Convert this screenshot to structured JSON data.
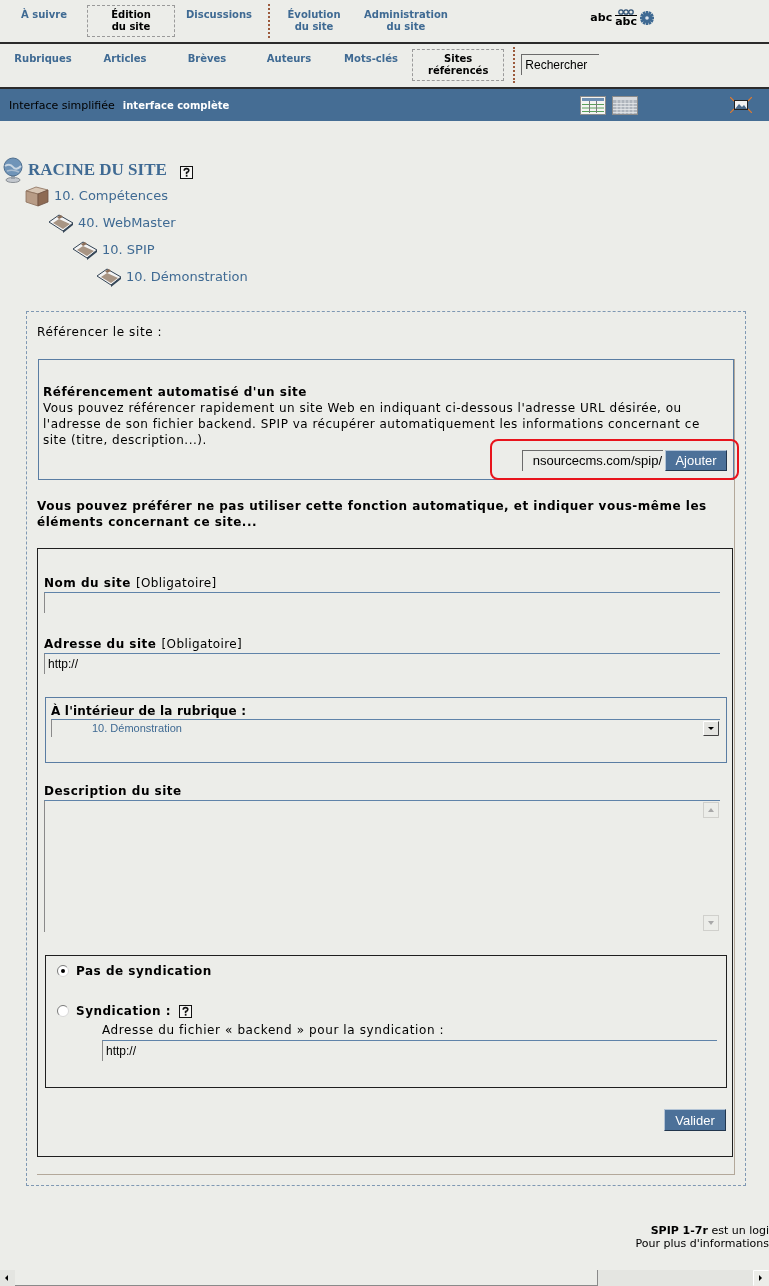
{
  "main_nav": {
    "groups": [
      [
        {
          "label": "À suivre",
          "selected": false
        },
        {
          "label": "Édition du site",
          "selected": true
        },
        {
          "label": "Discussions",
          "selected": false
        }
      ],
      [
        {
          "label": "Évolution du site",
          "selected": false
        },
        {
          "label": "Administration du site",
          "selected": false
        }
      ]
    ],
    "tools": [
      {
        "kind": "text",
        "label": "abc"
      },
      {
        "kind": "stacked",
        "label": "abc"
      },
      {
        "kind": "gear"
      }
    ]
  },
  "sub_nav": {
    "items": [
      {
        "label": "Rubriques",
        "selected": false
      },
      {
        "label": "Articles",
        "selected": false
      },
      {
        "label": "Brèves",
        "selected": false
      },
      {
        "label": "Auteurs",
        "selected": false
      },
      {
        "label": "Mots-clés",
        "selected": false
      },
      {
        "label": "Sites référencés",
        "selected": true
      }
    ],
    "search": {
      "value": "Rechercher"
    }
  },
  "mode_bar": {
    "links": [
      {
        "label": "Interface simplifiée",
        "selected": false
      },
      {
        "label": "interface complète",
        "selected": true
      }
    ]
  },
  "breadcrumb": {
    "title": "RACINE DU SITE",
    "help": true,
    "children": [
      {
        "kind": "sector",
        "label": "10. Compétences",
        "children": [
          {
            "kind": "folder",
            "label": "40. WebMaster",
            "children": [
              {
                "kind": "folder",
                "label": "10. SPIP",
                "children": [
                  {
                    "kind": "folder",
                    "label": "10. Démonstration"
                  }
                ]
              }
            ]
          }
        ]
      }
    ]
  },
  "form": {
    "heading": "Référencer le site :",
    "auto": {
      "title": "Référencement automatisé d'un site",
      "text": "Vous pouvez référencer rapidement un site Web en indiquant ci-dessous l'adresse URL désirée, ou l'adresse de son fichier backend. SPIP va récupérer automatiquement les informations concernant ce site (titre, description...).",
      "url_field": {
        "value": "nsourcecms.com/spip/"
      },
      "button": "Ajouter",
      "highlighted": true
    },
    "manual_intro": "Vous pouvez préférer ne pas utiliser cette fonction automatique, et indiquer vous-même les éléments concernant ce site...",
    "fields": [
      {
        "kind": "text",
        "label": "Nom du site",
        "note": "[Obligatoire]"
      },
      {
        "kind": "text",
        "label": "Adresse du site",
        "note": "[Obligatoire]",
        "value": "http://"
      },
      {
        "kind": "select",
        "label": "À l'intérieur de la rubrique :",
        "value": "10. Démonstration"
      },
      {
        "kind": "textarea",
        "label": "Description du site"
      }
    ],
    "syndication": {
      "options": [
        {
          "label": "Pas de syndication",
          "selected": true,
          "help": false
        },
        {
          "label": "Syndication :",
          "selected": false,
          "help": true
        }
      ],
      "backend_label": "Adresse du fichier « backend » pour la syndication :",
      "backend_field": {
        "value": "http://"
      }
    },
    "submit": "Valider"
  },
  "footer": {
    "lines": [
      "**SPIP 1-7r** est un logi",
      "Pour plus d'informations"
    ]
  }
}
